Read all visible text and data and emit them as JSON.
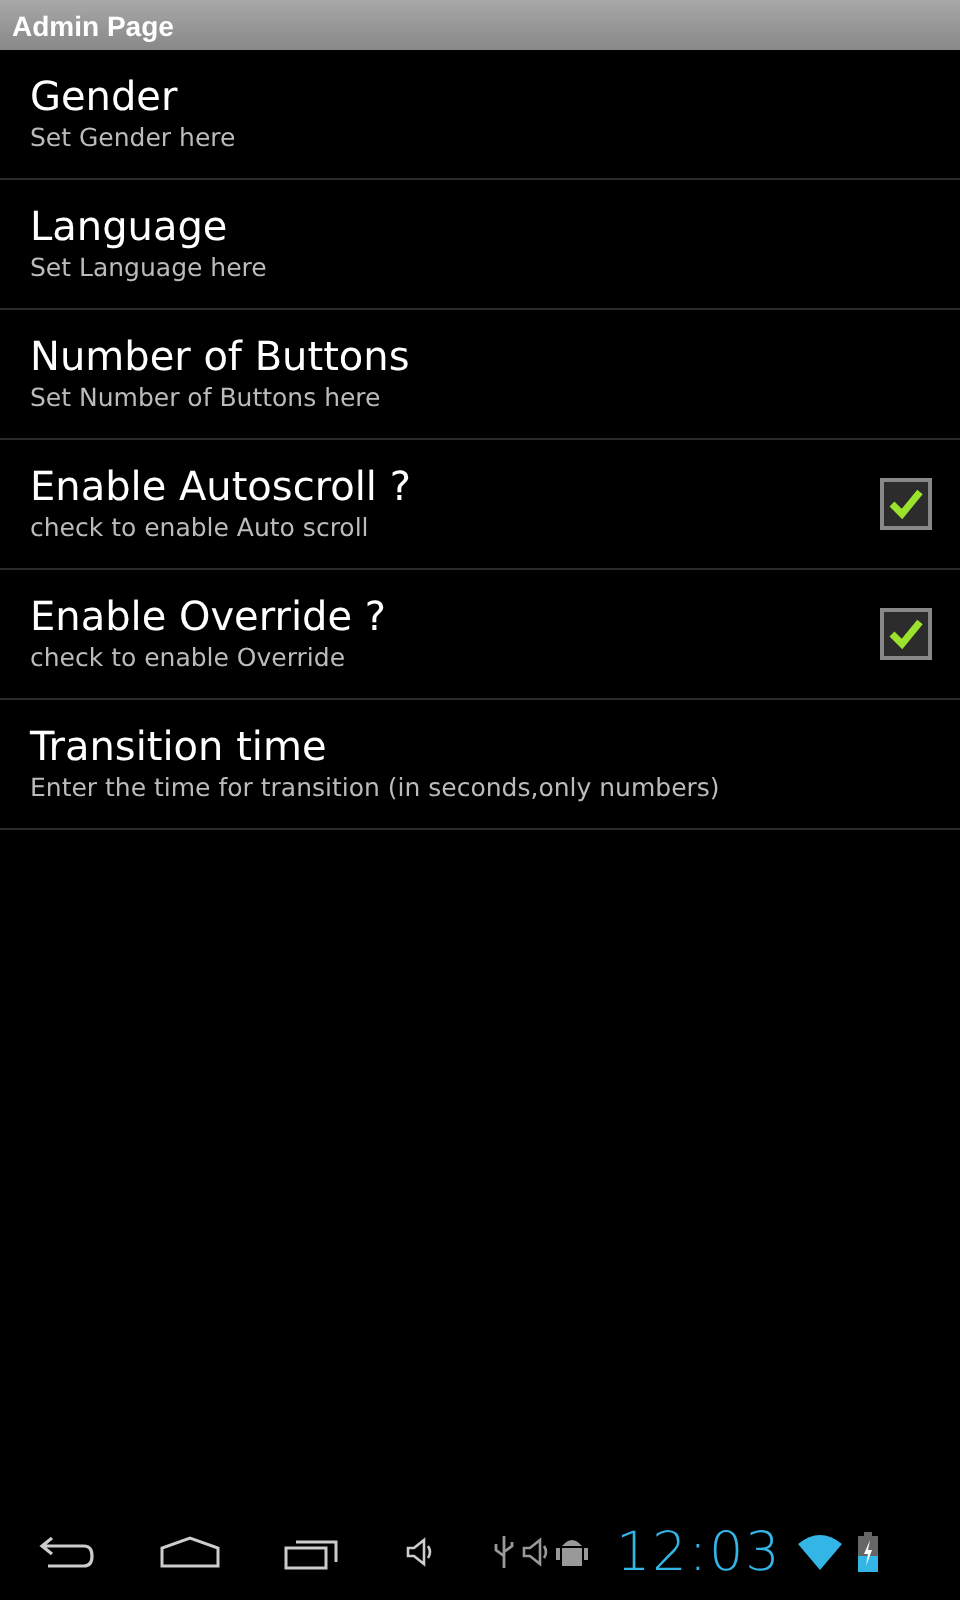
{
  "window": {
    "title": "Admin Page"
  },
  "settings": [
    {
      "kind": "text",
      "title": "Gender",
      "summary": "Set Gender here"
    },
    {
      "kind": "text",
      "title": "Language",
      "summary": "Set Language here"
    },
    {
      "kind": "text",
      "title": "Number of Buttons",
      "summary": "Set Number of Buttons here"
    },
    {
      "kind": "checkbox",
      "title": "Enable Autoscroll ?",
      "summary": "check to enable Auto scroll",
      "checked": true
    },
    {
      "kind": "checkbox",
      "title": "Enable Override ?",
      "summary": "check to enable Override",
      "checked": true
    },
    {
      "kind": "text",
      "title": "Transition time",
      "summary": "Enter the time for transition (in seconds,only numbers)"
    }
  ],
  "status_bar": {
    "clock": "12:03"
  }
}
